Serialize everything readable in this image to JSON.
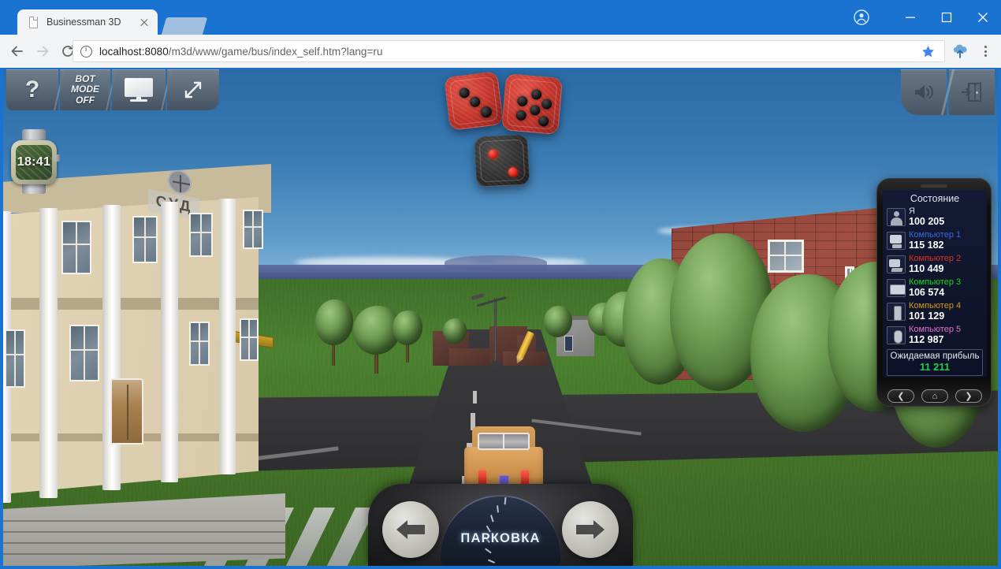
{
  "browser": {
    "tab": {
      "title": "Businessman 3D",
      "favicon": "page-icon",
      "close": "×"
    },
    "url_prefix": "localhost:8080",
    "url_rest": "/m3d/www/game/bus/index_self.htm?lang=ru",
    "url_full": "localhost:8080/m3d/www/game/bus/index_self.htm?lang=ru",
    "nav": {
      "back": "back-arrow",
      "forward": "forward-arrow",
      "reload": "reload-icon"
    },
    "omnibox": {
      "info_icon": "info-icon",
      "star_icon": "bookmark-star-icon"
    },
    "toolbar_icons": {
      "cloud": "cloud-upload-icon",
      "menu": "three-dot-menu-icon"
    },
    "window": {
      "profile": "profile-avatar-icon",
      "minimize": "—",
      "maximize": "□",
      "close": "×"
    }
  },
  "hud": {
    "left_buttons": [
      {
        "name": "help-button",
        "label": "?"
      },
      {
        "name": "bot-mode-button",
        "label": "BOT\nMODE\nOFF",
        "line1": "BOT",
        "line2": "MODE",
        "line3": "OFF"
      },
      {
        "name": "monitor-button",
        "label": "monitor-icon"
      },
      {
        "name": "fullscreen-button",
        "label": "fullscreen-arrows-icon"
      }
    ],
    "right_buttons": [
      {
        "name": "sound-button",
        "label": "speaker-icon"
      },
      {
        "name": "exit-button",
        "label": "exit-door-icon"
      }
    ],
    "watch": {
      "time": "18:41",
      "name": "wrist-watch"
    }
  },
  "dice": [
    {
      "name": "die-red-1",
      "color": "#c8362c",
      "value": 3,
      "pip_color": "#0b0b0b"
    },
    {
      "name": "die-red-2",
      "color": "#c8362c",
      "value": 6,
      "pip_color": "#0b0b0b"
    },
    {
      "name": "die-black",
      "color": "#2b2b2b",
      "value": 2,
      "pip_color": "#cc1408"
    }
  ],
  "phone": {
    "title": "Состояние",
    "players": [
      {
        "icon": "person-icon",
        "name": "Я",
        "value": "100 205",
        "color": "#d8dce6"
      },
      {
        "icon": "crt-icon",
        "name": "Компьютер 1",
        "value": "115 182",
        "color": "#3a6ae0"
      },
      {
        "icon": "crt-icon",
        "name": "Компьютер 2",
        "value": "110 449",
        "color": "#e23024"
      },
      {
        "icon": "lcd-icon",
        "name": "Компьютер 3",
        "value": "106 574",
        "color": "#16d916"
      },
      {
        "icon": "phone-icon",
        "name": "Компьютер 4",
        "value": "101 129",
        "color": "#d79a16"
      },
      {
        "icon": "mouse-icon",
        "name": "Компьютер 5",
        "value": "112 987",
        "color": "#e470c8"
      }
    ],
    "profit": {
      "label": "Ожидаемая прибыль",
      "value": "11 211",
      "color": "#27cc4e"
    },
    "nav": [
      {
        "name": "prev-button",
        "label": "❮"
      },
      {
        "name": "home-button",
        "label": "⌂"
      },
      {
        "name": "next-button",
        "label": "❯"
      }
    ]
  },
  "controls": {
    "left_arrow": "◀",
    "right_arrow": "▶",
    "gauge_label": "ПАРКОВКА"
  },
  "scene": {
    "court_sign": "СУД",
    "sky_color": "#2f6fa8",
    "grass_color": "#457a2c",
    "road_color": "#333335",
    "car_color": "#cf9550",
    "brick_color": "#8e4239"
  }
}
